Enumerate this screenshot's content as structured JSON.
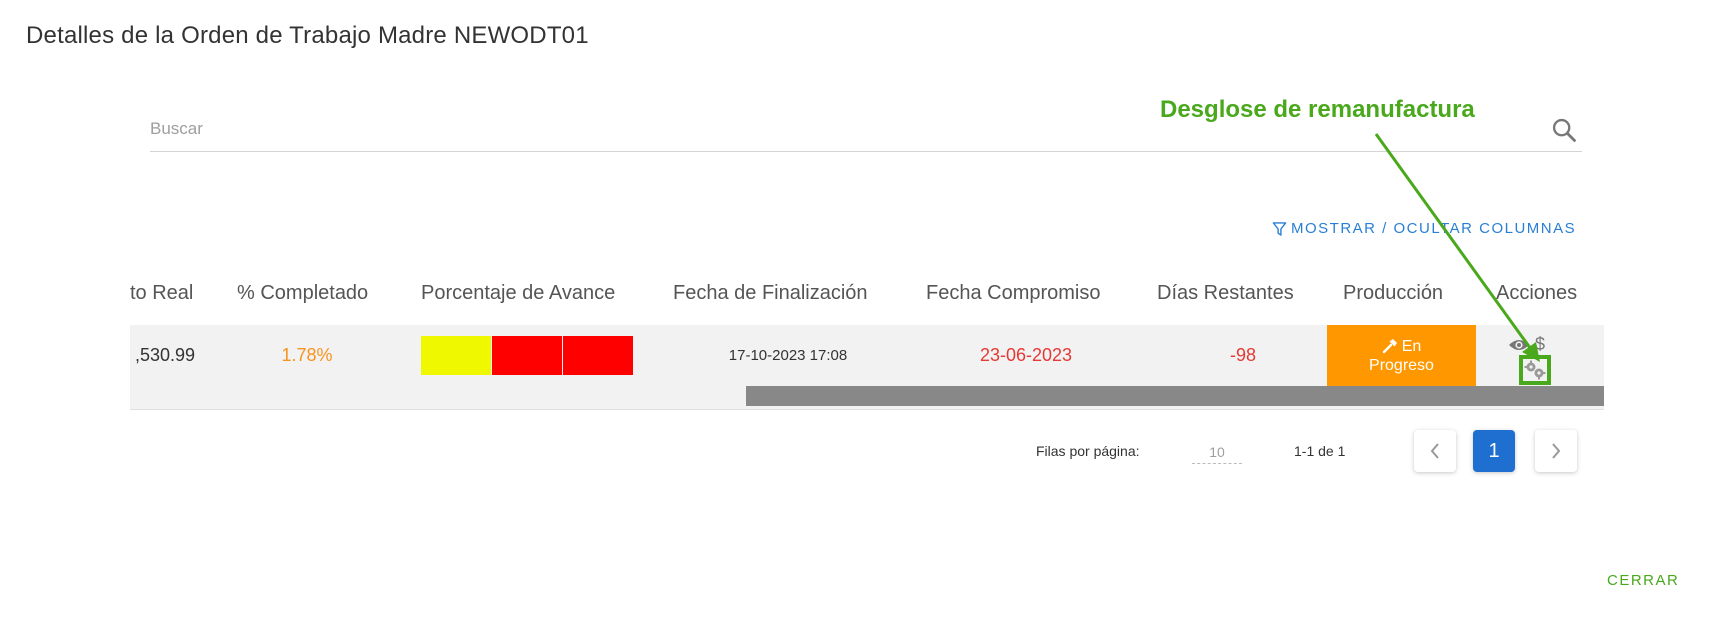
{
  "dialog": {
    "title": "Detalles de la Orden de Trabajo Madre NEWODT01"
  },
  "search": {
    "placeholder": "Buscar",
    "value": ""
  },
  "annotation": {
    "label": "Desglose de remanufactura",
    "color": "#4aa81c"
  },
  "toolbar": {
    "toggle_columns_label": "MOSTRAR / OCULTAR COLUMNAS"
  },
  "table": {
    "headers": [
      "to Real",
      "% Completado",
      "Porcentaje de Avance",
      "Fecha de Finalización",
      "Fecha Compromiso",
      "Días Restantes",
      "Producción",
      "Acciones"
    ],
    "rows": [
      {
        "costo_real": ",530.99",
        "completado": "1.78%",
        "avance_segments": [
          "yellow",
          "red",
          "red"
        ],
        "fecha_finalizacion": "17-10-2023 17:08",
        "fecha_compromiso": "23-06-2023",
        "dias_restantes": "-98",
        "produccion_line1": "En",
        "produccion_line2": "Progreso",
        "acciones": [
          "eye-icon",
          "dollar-icon",
          "gears-icon"
        ]
      }
    ]
  },
  "pagination": {
    "rows_per_page_label": "Filas por página:",
    "rows_per_page": "10",
    "range": "1-1 de 1",
    "current_page": "1"
  },
  "footer": {
    "close_label": "CERRAR"
  },
  "colors": {
    "accent_blue": "#2a7fd4",
    "production_orange": "#ff9800",
    "danger_red": "#e53935",
    "warning_orange": "#f7931e",
    "page_active": "#1f6fd0",
    "annotation_green": "#4aa81c"
  }
}
